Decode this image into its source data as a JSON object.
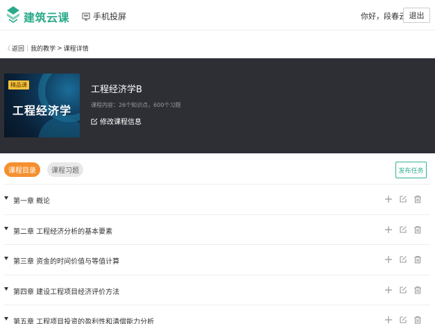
{
  "header": {
    "brand": "建筑云课",
    "cast_label": "手机投屏",
    "greeting": "你好，段春云",
    "logout_label": "退出",
    "brand_color": "#2aaa8a"
  },
  "breadcrumb": {
    "back": "返回",
    "parent": "我的教学",
    "current": "课程详情"
  },
  "course": {
    "badge": "精品课",
    "cover_title": "工程经济学",
    "title": "工程经济学B",
    "meta": "课程内容：26个知识点，600个习题",
    "edit_label": "修改课程信息"
  },
  "tabs": {
    "catalog": "课程目录",
    "exercises": "课程习题",
    "publish": "发布任务",
    "active_color": "#f5902f"
  },
  "chapters": [
    {
      "title": "第一章 概论"
    },
    {
      "title": "第二章 工程经济分析的基本要素"
    },
    {
      "title": "第三章 资金的时间价值与等值计算"
    },
    {
      "title": "第四章 建设工程项目经济评价方法"
    },
    {
      "title": "第五章 工程项目投资的盈利性和清偿能力分析"
    }
  ],
  "icons": {
    "add": "plus-icon",
    "edit": "edit-icon",
    "delete": "trash-icon"
  }
}
